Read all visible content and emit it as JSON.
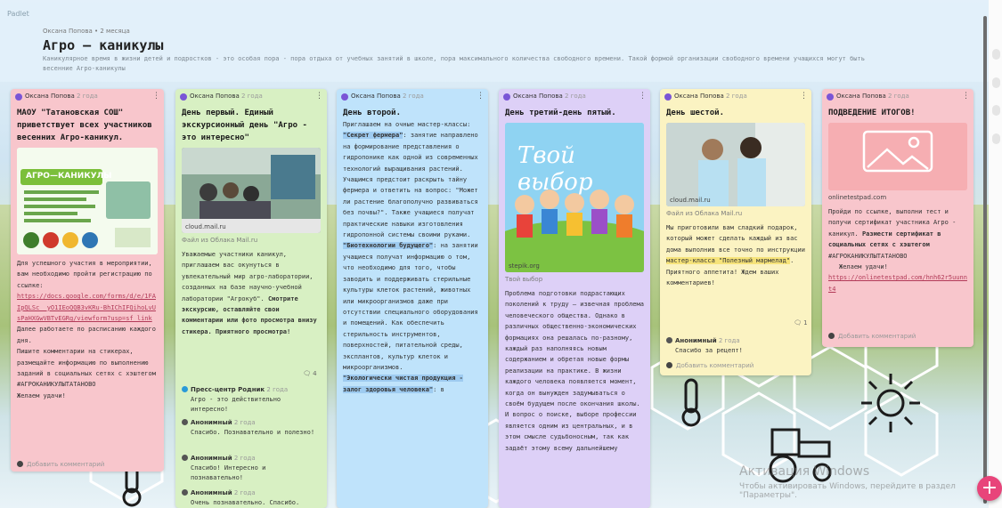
{
  "brand": "Padlet",
  "header": {
    "meta": "Оксана Попова • 2 месяца",
    "title": "Агро – каникулы",
    "description": "Каникулярное время в жизни детей и подростков - это особая пора - пора отдыха от учебных занятий в школе, пора максимального количества свободного времени. Такой формой организации свободного времени учащихся могут быть весенние Агро-каникулы"
  },
  "watermark": {
    "title": "Активация Windows",
    "subtitle": "Чтобы активировать Windows, перейдите в раздел \"Параметры\"."
  },
  "colors": {
    "pink": "#f8c6cc",
    "green": "#d8f0c3",
    "blue": "#bfe3fb",
    "purple": "#ddd0f7",
    "yellow": "#fbf3c2",
    "fab": "#e8447a"
  },
  "cards": [
    {
      "author": "Оксана Попова",
      "age": "2 года",
      "title": "МАОУ \"Татановская СОШ\" приветствует всех участников весенних Агро-каникул.",
      "image_caption": "АГРО—КАНИКУЛЫ",
      "text1": "Для успешного участия в мероприятии, вам необходимо пройти регистрацию по ссылке:",
      "link": "https://docs.google.com/forms/d/e/1FAIpQLSc__yO1IEoQQB3vKRu-BhIChIFQihoLvUsPaHXGwVBTvEGRg/viewform?usp=sf_link",
      "text2": "Далее работаете по расписанию каждого дня.",
      "text3": "Пишите комментарии на стикерах, размещайте информацию по выполнению заданий в социальных сетях с хэштегом #АГРОКАНИКУЛЫТАТАНОВО",
      "text4": "Желаем удачи!",
      "add_comment": "Добавить комментарий"
    },
    {
      "author": "Оксана Попова",
      "age": "2 года",
      "title": "День первый. Единый экскурсионный день \"Агро - это интересно\"",
      "image_source": "cloud.mail.ru",
      "image_caption": "Файл из Облака Mail.ru",
      "text1": "Уважаемые участники каникул, приглашаем вас окунуться в увлекательный мир агро-лаборатории, созданных на базе научно-учебной лаборатории \"Агрокуб\".",
      "text1b": "Смотрите экскурсию, оставляйте свои комментарии или фото просмотра внизу стикера. Приятного просмотра!",
      "count": "4",
      "comments": [
        {
          "name": "Пресс-центр Родник",
          "time": "2 года",
          "text": "Агро - это действительно интересно!"
        },
        {
          "name": "Анонимный",
          "time": "2 года",
          "text": "Спасибо. Познавательно и полезно!"
        },
        {
          "name": "Анонимный",
          "time": "2 года",
          "text": "Спасибо! Интересно и познавательно!"
        },
        {
          "name": "Анонимный",
          "time": "2 года",
          "text": "Очень познавательно. Спасибо."
        }
      ]
    },
    {
      "author": "Оксана Попова",
      "age": "2 года",
      "title": "День второй.",
      "intro": "Приглашаем на очные мастер-классы:",
      "hl1": "\"Секрет фермера\"",
      "text1": ": занятие направлено на формирование представления о гидропонике как одной из современных технологий выращивания растений. Учащимся предстоит раскрыть тайну фермера и ответить на вопрос: \"Может ли растение благополучно развиваться без почвы?\". Также учащиеся получат практические навыки изготовления гидропонной системы своими руками.",
      "hl2": "\"Биотехнологии будущего\"",
      "text2": ": на занятии учащиеся получат информацию о том, что необходимо для того, чтобы заводить и поддерживать стерильные культуры клеток растений, животных или микроорганизмов даже при отсутствии специального оборудования и помещений. Как обеспечить стерильность инструментов, поверхностей, питательной среды, эксплантов, культур клеток и микроорганизмов.",
      "hl3": "\"Экологически чистая продукция - залог здоровья человека\"",
      "text3": ": в"
    },
    {
      "author": "Оксана Попова",
      "age": "2 года",
      "title": "День третий-день пятый.",
      "image_text": "Твой выбор",
      "image_source": "stepik.org",
      "image_caption": "Твой выбор",
      "text1": "Проблема подготовки подрастающих поколений к труду – извечная проблема человеческого общества. Однако в различных общественно-экономических формациях она решалась по-разному, каждый раз наполняясь новым содержанием и обретая новые формы реализации на практике. В жизни каждого человека появляется момент, когда он вынужден задумываться о своём будущем после окончания школы. И вопрос о поиске, выборе профессии является одним из центральных, и в этом смысле судьбоносным, так как задаёт этому всему дальнейшему"
    },
    {
      "author": "Оксана Попова",
      "age": "2 года",
      "title": "День шестой.",
      "image_source": "cloud.mail.ru",
      "image_caption": "Файл из Облака Mail.ru",
      "text1": "Мы приготовили вам сладкий подарок, который может сделать каждый из вас дома выполнив все точно по инструкции",
      "hl1": "мастер-класса \"Полезный мармелад\"",
      "text2": ". Приятного аппетита! Ждем ваших комментариев!",
      "count": "1",
      "comment": {
        "name": "Анонимный",
        "time": "2 года",
        "text": "Спасибо за рецепт!"
      },
      "add_comment": "Добавить комментарий"
    },
    {
      "author": "Оксана Попова",
      "age": "2 года",
      "title": "ПОДВЕДЕНИЕ ИТОГОВ!",
      "image_source": "onlinetestpad.com",
      "text1": "Пройди по ссылке, выполни тест и получи сертификат участника Агро - каникул.",
      "text1b": "Размести сертификат в социальных сетях с хэштегом",
      "tag": "#АГРОКАНИКУЛЫТАТАНОВО",
      "text2": "Желаем удачи!",
      "link": "https://onlinetestpad.com/hnh62r5uunnt4",
      "add_comment": "Добавить комментарий"
    }
  ]
}
